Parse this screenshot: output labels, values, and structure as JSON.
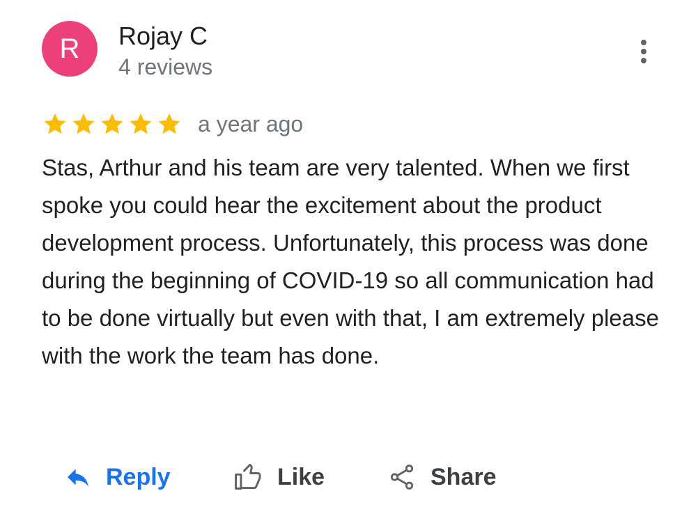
{
  "review": {
    "author": {
      "initial": "R",
      "name": "Rojay C",
      "reviews_count": "4 reviews",
      "avatar_color": "#ec407a"
    },
    "menu_icon": "more-vert-icon",
    "rating": 5,
    "rating_max": 5,
    "star_color": "#fbbc04",
    "date": "a year ago",
    "text": "Stas, Arthur and his team are very talented. When we first spoke you could hear the excitement about the product development process. Unfortunately, this process was done during the beginning of COVID-19 so all communication had to be done virtually but even with that, I am extremely please with the work the team has done."
  },
  "actions": {
    "reply": {
      "label": "Reply",
      "icon": "reply-icon",
      "color": "#1a73e8"
    },
    "like": {
      "label": "Like",
      "icon": "thumb-up-icon"
    },
    "share": {
      "label": "Share",
      "icon": "share-icon"
    }
  }
}
